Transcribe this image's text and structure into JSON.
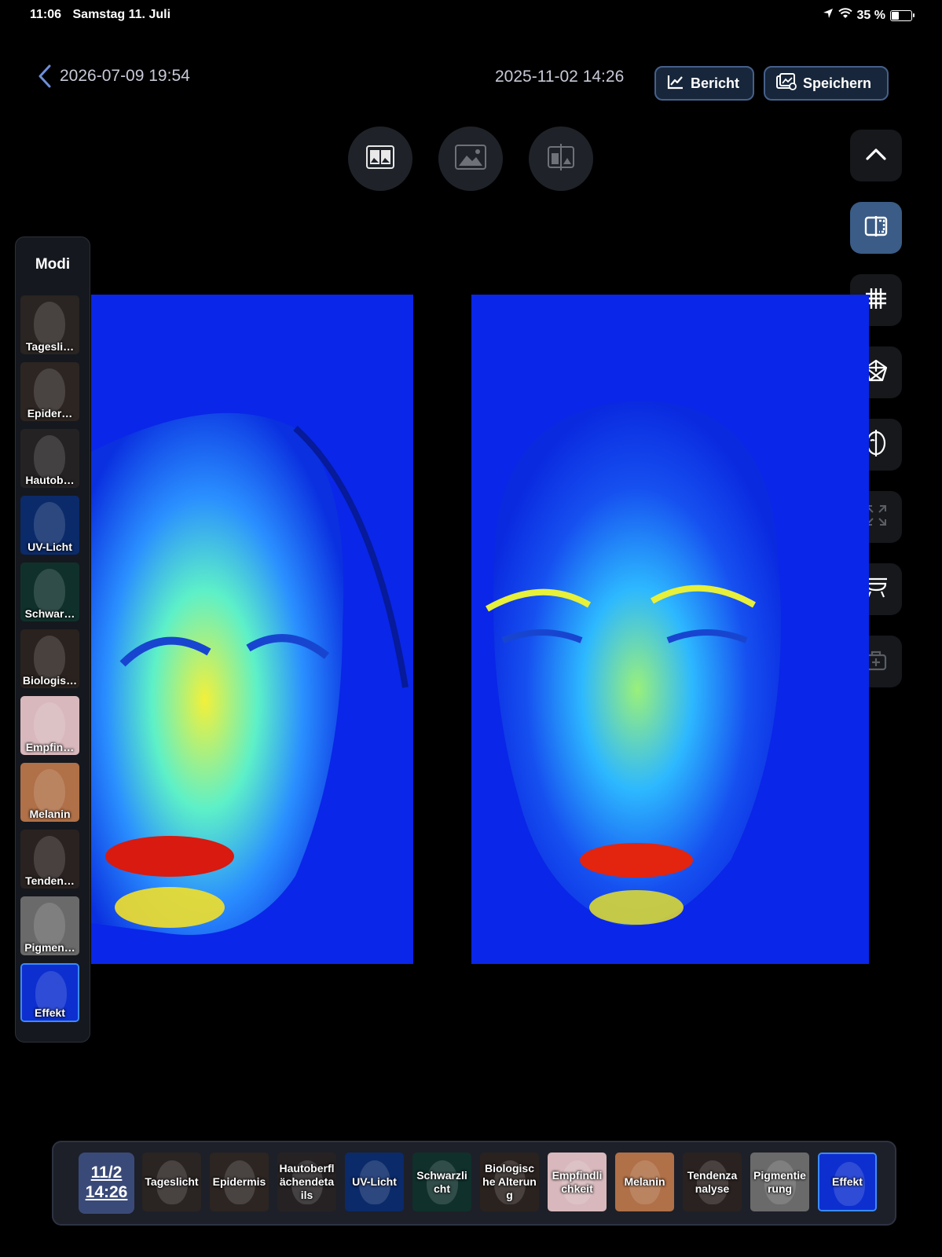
{
  "status_bar": {
    "time": "11:06",
    "date": "Samstag 11. Juli",
    "battery": "35 %",
    "battery_level": 0.35
  },
  "header": {
    "current_date": "2026-07-09 19:54",
    "compare_date": "2025-11-02 14:26",
    "report_label": "Bericht",
    "save_label": "Speichern"
  },
  "view_buttons": [
    "side-by-side-icon",
    "single-image-icon",
    "split-compare-icon"
  ],
  "right_toolbar": [
    "chevron-up-icon",
    "split-view-icon",
    "grid-icon",
    "face-mesh-icon",
    "face-symmetry-icon",
    "expand-icon",
    "lamp-icon",
    "toolbox-icon"
  ],
  "modes_panel": {
    "title": "Modi",
    "items": [
      {
        "label": "Tagesli…",
        "color": "#2a2422"
      },
      {
        "label": "Epider…",
        "color": "#2c2522"
      },
      {
        "label": "Hautob…",
        "color": "#252223"
      },
      {
        "label": "UV-Licht",
        "color": "#0b2a6a"
      },
      {
        "label": "Schwar…",
        "color": "#10302c"
      },
      {
        "label": "Biologis…",
        "color": "#2a221e"
      },
      {
        "label": "Empfin…",
        "color": "#d8b8bc"
      },
      {
        "label": "Melanin",
        "color": "#b07048"
      },
      {
        "label": "Tenden…",
        "color": "#2a2220"
      },
      {
        "label": "Pigmen…",
        "color": "#6a6a6a"
      },
      {
        "label": "Effekt",
        "color": "#0d2fd0"
      }
    ]
  },
  "bottom_bar": {
    "date_month": "11/2",
    "date_time": "14:26",
    "items": [
      {
        "label": "Tageslicht",
        "color": "#2a2422"
      },
      {
        "label": "Epidermis",
        "color": "#2c2522"
      },
      {
        "label": "Hautoberflächendetails",
        "color": "#262223"
      },
      {
        "label": "UV-Licht",
        "color": "#0b2a6a"
      },
      {
        "label": "Schwarzlicht",
        "color": "#10302c"
      },
      {
        "label": "Biologische Alterung",
        "color": "#2a221e"
      },
      {
        "label": "Empfindlichkeit",
        "color": "#d8b8bc"
      },
      {
        "label": "Melanin",
        "color": "#b07048"
      },
      {
        "label": "Tendenzanalyse",
        "color": "#2a2220"
      },
      {
        "label": "Pigmentierung",
        "color": "#6a6a6a"
      },
      {
        "label": "Effekt",
        "color": "#0d2fd0"
      }
    ]
  }
}
